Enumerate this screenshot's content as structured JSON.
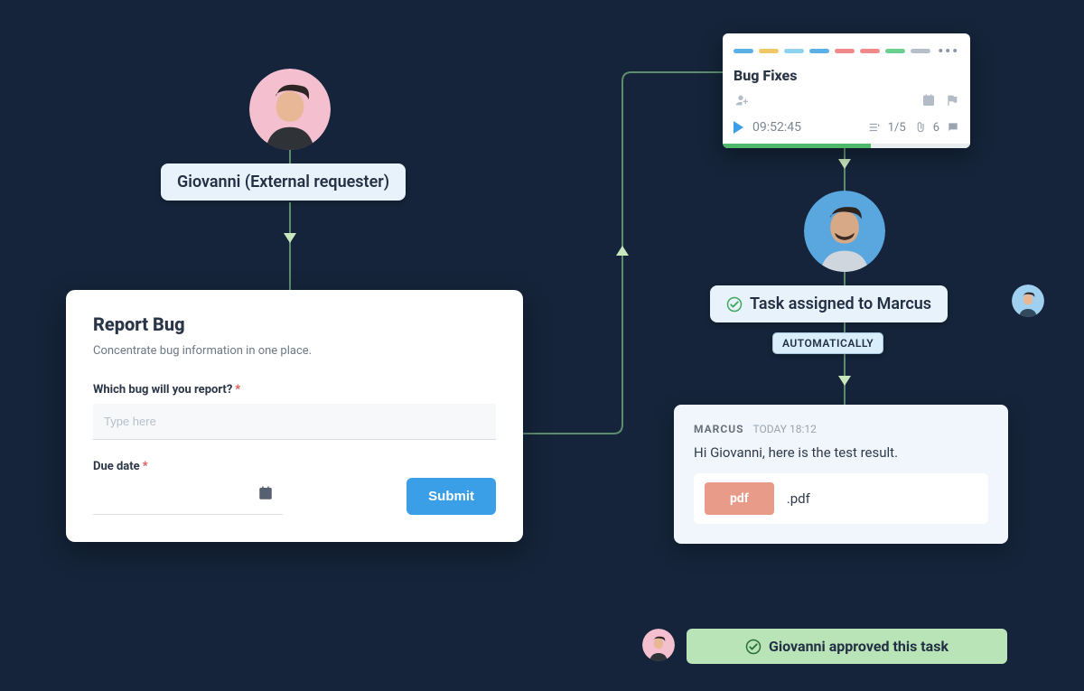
{
  "requester": {
    "name_label": "Giovanni (External requester)"
  },
  "form": {
    "title": "Report Bug",
    "subtitle": "Concentrate bug information in one place.",
    "q1_label": "Which bug will you report?",
    "q1_placeholder": "Type here",
    "q2_label": "Due date",
    "required_mark": "*",
    "submit_label": "Submit"
  },
  "task_card": {
    "title": "Bug Fixes",
    "timer": "09:52:45",
    "checklist": "1/5",
    "attachments": "6",
    "tag_colors": [
      "#5bb0e6",
      "#efc764",
      "#8fd2f0",
      "#5bb0e6",
      "#f08a8a",
      "#f08a8a",
      "#6bcf8f",
      "#b6bfc9"
    ]
  },
  "assignment": {
    "label": "Task assigned to Marcus",
    "auto_label": "AUTOMATICALLY"
  },
  "comment": {
    "author": "MARCUS",
    "time": "TODAY 18:12",
    "message": "Hi Giovanni, here is the test result.",
    "badge": "pdf",
    "file_ext": ".pdf"
  },
  "approval": {
    "label": "Giovanni approved this task"
  },
  "colors": {
    "accent_blue": "#3a9fe6",
    "green": "#4fb86b"
  }
}
